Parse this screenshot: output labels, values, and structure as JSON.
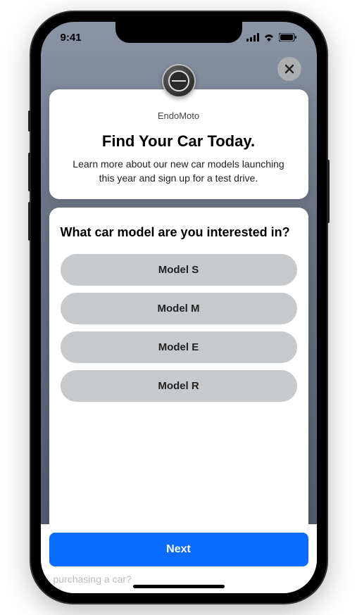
{
  "statusBar": {
    "time": "9:41"
  },
  "close": {
    "name": "close-icon"
  },
  "brand": "EndoMoto",
  "headline": "Find Your Car Today.",
  "subtext": "Learn more about our new car models launching this year and sign up for a test drive.",
  "question": "What car model are you interested in?",
  "options": [
    {
      "label": "Model S"
    },
    {
      "label": "Model M"
    },
    {
      "label": "Model E"
    },
    {
      "label": "Model R"
    }
  ],
  "nextButton": "Next",
  "ghostText": "purchasing a car?"
}
